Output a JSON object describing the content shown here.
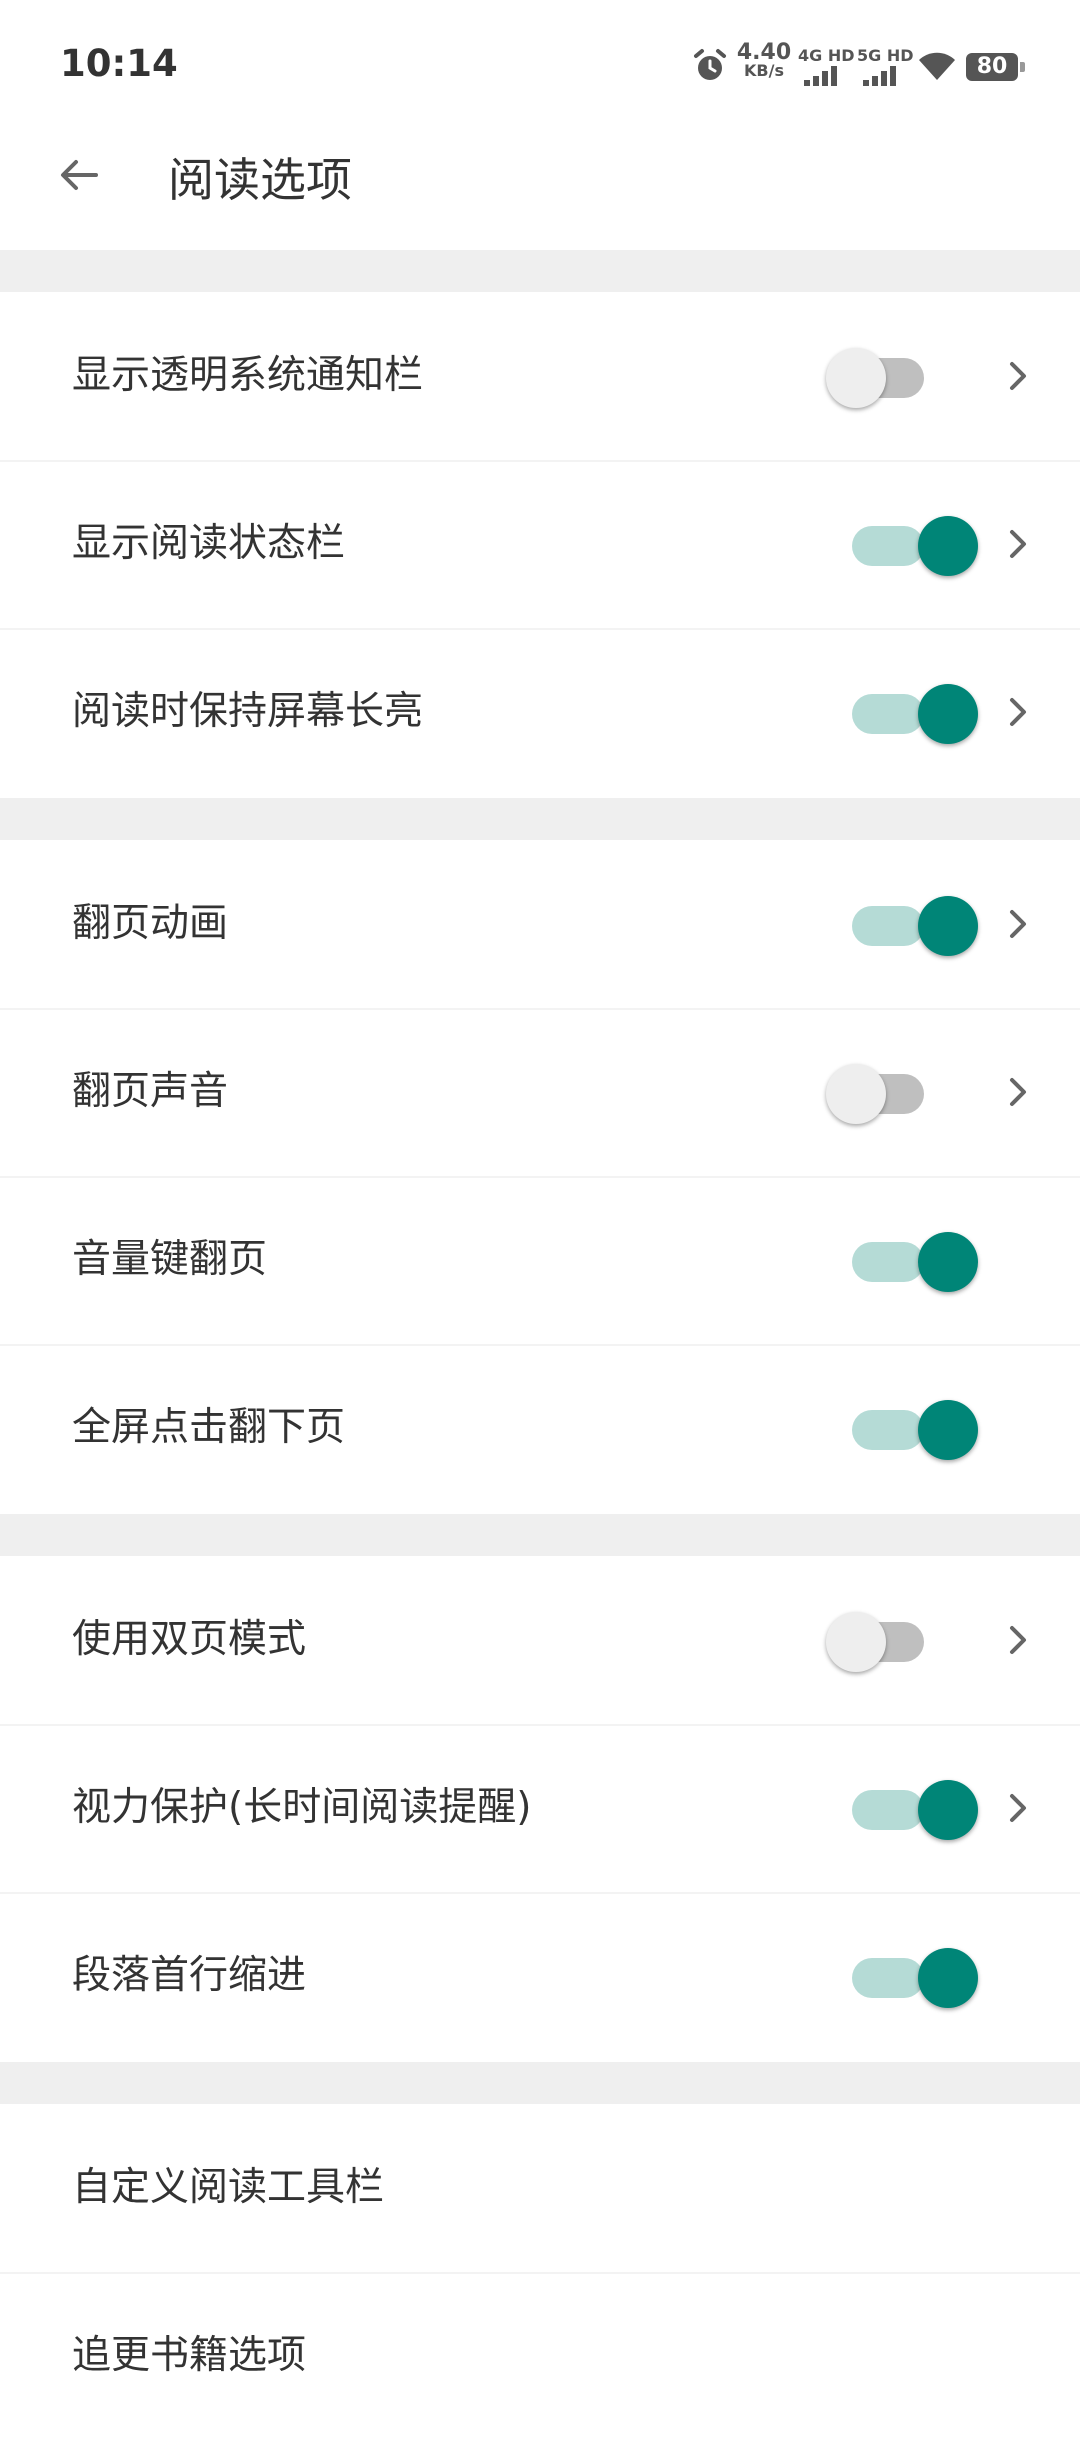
{
  "status_bar": {
    "time": "10:14",
    "net_speed_value": "4.40",
    "net_speed_unit": "KB/s",
    "sim1_label": "4G HD",
    "sim2_label": "5G HD",
    "battery": "80",
    "icons": [
      "alarm-icon",
      "signal-icon",
      "signal-icon",
      "wifi-icon",
      "battery-icon"
    ]
  },
  "header": {
    "title": "阅读选项",
    "back_icon": "arrow-left-icon"
  },
  "colors": {
    "accent": "#008577",
    "track_on": "#b5dbd6",
    "track_off": "#bfbfbf",
    "section_gap": "#efefef"
  },
  "sections": [
    {
      "items": [
        {
          "label": "显示透明系统通知栏",
          "toggle": false,
          "has_chevron": true
        },
        {
          "label": "显示阅读状态栏",
          "toggle": true,
          "has_chevron": true
        },
        {
          "label": "阅读时保持屏幕长亮",
          "toggle": true,
          "has_chevron": true
        }
      ]
    },
    {
      "items": [
        {
          "label": "翻页动画",
          "toggle": true,
          "has_chevron": true
        },
        {
          "label": "翻页声音",
          "toggle": false,
          "has_chevron": true
        },
        {
          "label": "音量键翻页",
          "toggle": true,
          "has_chevron": false
        },
        {
          "label": "全屏点击翻下页",
          "toggle": true,
          "has_chevron": false
        }
      ]
    },
    {
      "items": [
        {
          "label": "使用双页模式",
          "toggle": false,
          "has_chevron": true
        },
        {
          "label": "视力保护(长时间阅读提醒)",
          "toggle": true,
          "has_chevron": true
        },
        {
          "label": "段落首行缩进",
          "toggle": true,
          "has_chevron": false
        }
      ]
    },
    {
      "items": [
        {
          "label": "自定义阅读工具栏"
        },
        {
          "label": "追更书籍选项"
        }
      ]
    }
  ]
}
